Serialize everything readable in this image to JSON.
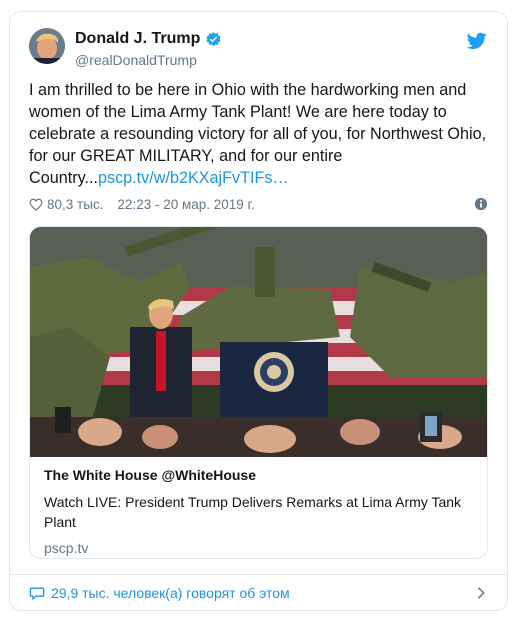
{
  "tweet": {
    "author_name": "Donald J. Trump",
    "handle": "@realDonaldTrump",
    "text": "I am thrilled to be here in Ohio with the hardworking men and women of the Lima Army Tank Plant! We are here today to celebrate a resounding victory for all of you, for Northwest Ohio, for our GREAT MILITARY, and for our entire Country...",
    "link": "pscp.tv/w/b2KXajFvTIFs…",
    "likes": "80,3 тыс.",
    "timestamp": "22:23 - 20 мар. 2019 г.",
    "embed": {
      "author": "The White House @WhiteHouse",
      "title": "Watch LIVE: President Trump Delivers Remarks at Lima Army Tank Plant",
      "domain": "pscp.tv"
    },
    "footer": "29,9 тыс. человек(а) говорят об этом"
  },
  "colors": {
    "link": "#1b95e0",
    "muted": "#657786",
    "border": "#e1e8ed"
  },
  "icons": [
    "verified-icon",
    "twitter-bird-icon",
    "heart-icon",
    "info-icon",
    "reply-bubble-icon",
    "chevron-right-icon"
  ]
}
